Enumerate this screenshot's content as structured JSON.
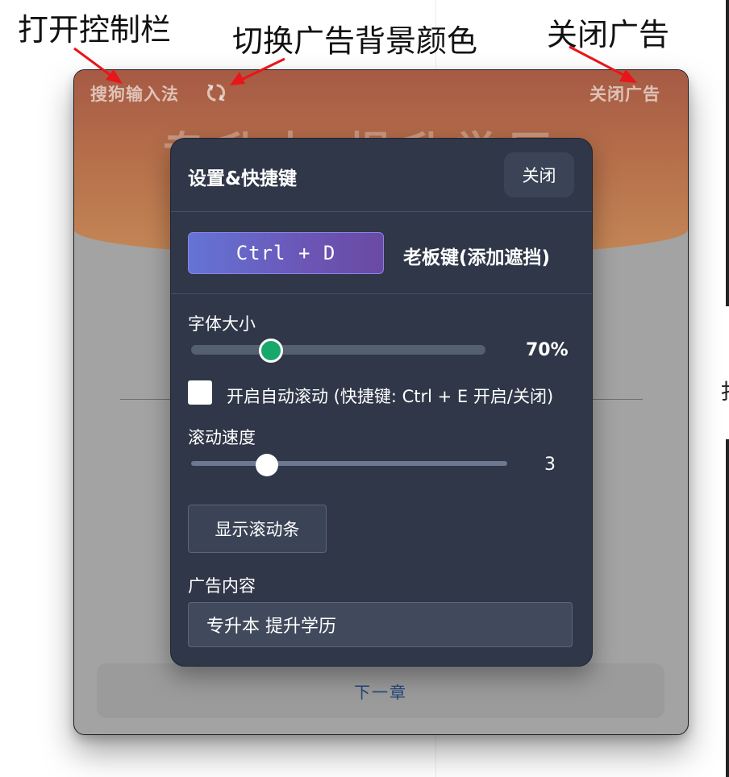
{
  "annotations": {
    "toggle_controls": "打开控制栏",
    "switch_ad_color": "切换广告背景颜色",
    "close_ad": "关闭广告"
  },
  "ad_bar": {
    "brand": "搜狗输入法",
    "close_label": "关闭广告",
    "refresh_icon": "refresh-icon",
    "content_text": "专升本 提升学历"
  },
  "settings": {
    "title": "设置&快捷键",
    "close_label": "关闭",
    "boss_key": {
      "shortcut": "Ctrl + D",
      "label": "老板键(添加遮挡)"
    },
    "font_size": {
      "label": "字体大小",
      "value": "70%",
      "level_fraction": 0.27
    },
    "auto_scroll": {
      "label": "开启自动滚动 (快捷键: Ctrl + E 开启/关闭)",
      "checked": false
    },
    "scroll_speed": {
      "label": "滚动速度",
      "value": "3"
    },
    "show_scrollbar_label": "显示滚动条",
    "ad_content": {
      "label": "广告内容",
      "value": "专升本 提升学历"
    }
  },
  "reader": {
    "next_chapter_label": "下一章"
  },
  "colors": {
    "ad_banner_top": "#a65a44",
    "ad_banner_bottom": "#c48756",
    "panel_bg": "#2f3748",
    "font_slider_thumb": "#18a86b",
    "boss_key_gradient_start": "#6474d6",
    "boss_key_gradient_end": "#6a4aa3",
    "annotation_arrow": "#e8151b"
  }
}
